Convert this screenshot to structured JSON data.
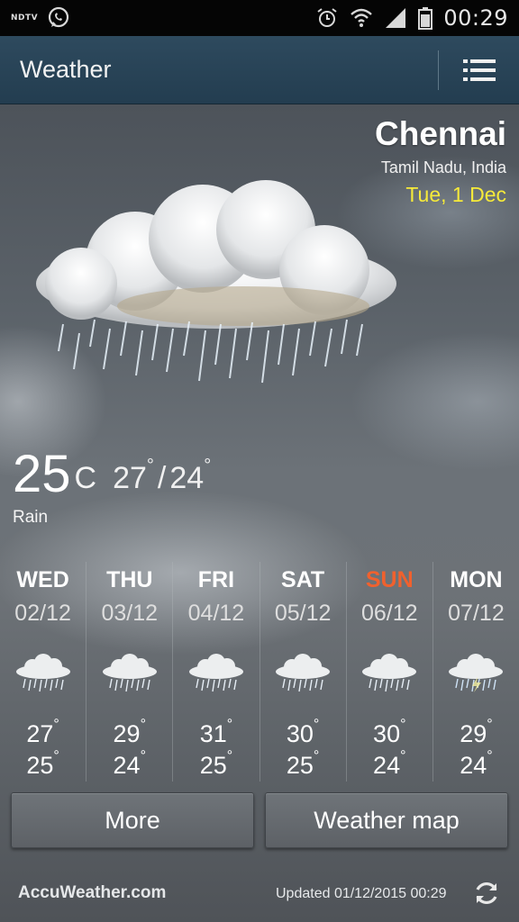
{
  "status_bar": {
    "left_label": "NDTV",
    "time": "00:29",
    "icons": [
      "whatsapp-icon",
      "alarm-icon",
      "wifi-icon",
      "signal-icon",
      "battery-icon"
    ]
  },
  "action_bar": {
    "title": "Weather",
    "menu_icon": "menu-icon"
  },
  "location": {
    "city": "Chennai",
    "region": "Tamil Nadu, India",
    "date": "Tue, 1 Dec"
  },
  "current": {
    "temp": "25",
    "unit": "C",
    "high": "27",
    "low": "24",
    "condition": "Rain",
    "icon": "rain-cloud-icon"
  },
  "forecast": [
    {
      "day": "WED",
      "date": "02/12",
      "high": "27",
      "low": "25",
      "icon": "rain-cloud-icon"
    },
    {
      "day": "THU",
      "date": "03/12",
      "high": "29",
      "low": "24",
      "icon": "rain-cloud-icon"
    },
    {
      "day": "FRI",
      "date": "04/12",
      "high": "31",
      "low": "25",
      "icon": "rain-cloud-icon"
    },
    {
      "day": "SAT",
      "date": "05/12",
      "high": "30",
      "low": "25",
      "icon": "rain-cloud-icon"
    },
    {
      "day": "SUN",
      "date": "06/12",
      "high": "30",
      "low": "24",
      "icon": "rain-cloud-icon"
    },
    {
      "day": "MON",
      "date": "07/12",
      "high": "29",
      "low": "24",
      "icon": "thunderstorm-cloud-icon"
    }
  ],
  "buttons": {
    "more": "More",
    "weather_map": "Weather map"
  },
  "footer": {
    "brand": "AccuWeather.com",
    "updated": "Updated 01/12/2015 00:29",
    "refresh_icon": "refresh-icon"
  },
  "colors": {
    "action_bar": "#2e4a5e",
    "date_highlight": "#f6ea3a",
    "sunday": "#f0612e"
  }
}
